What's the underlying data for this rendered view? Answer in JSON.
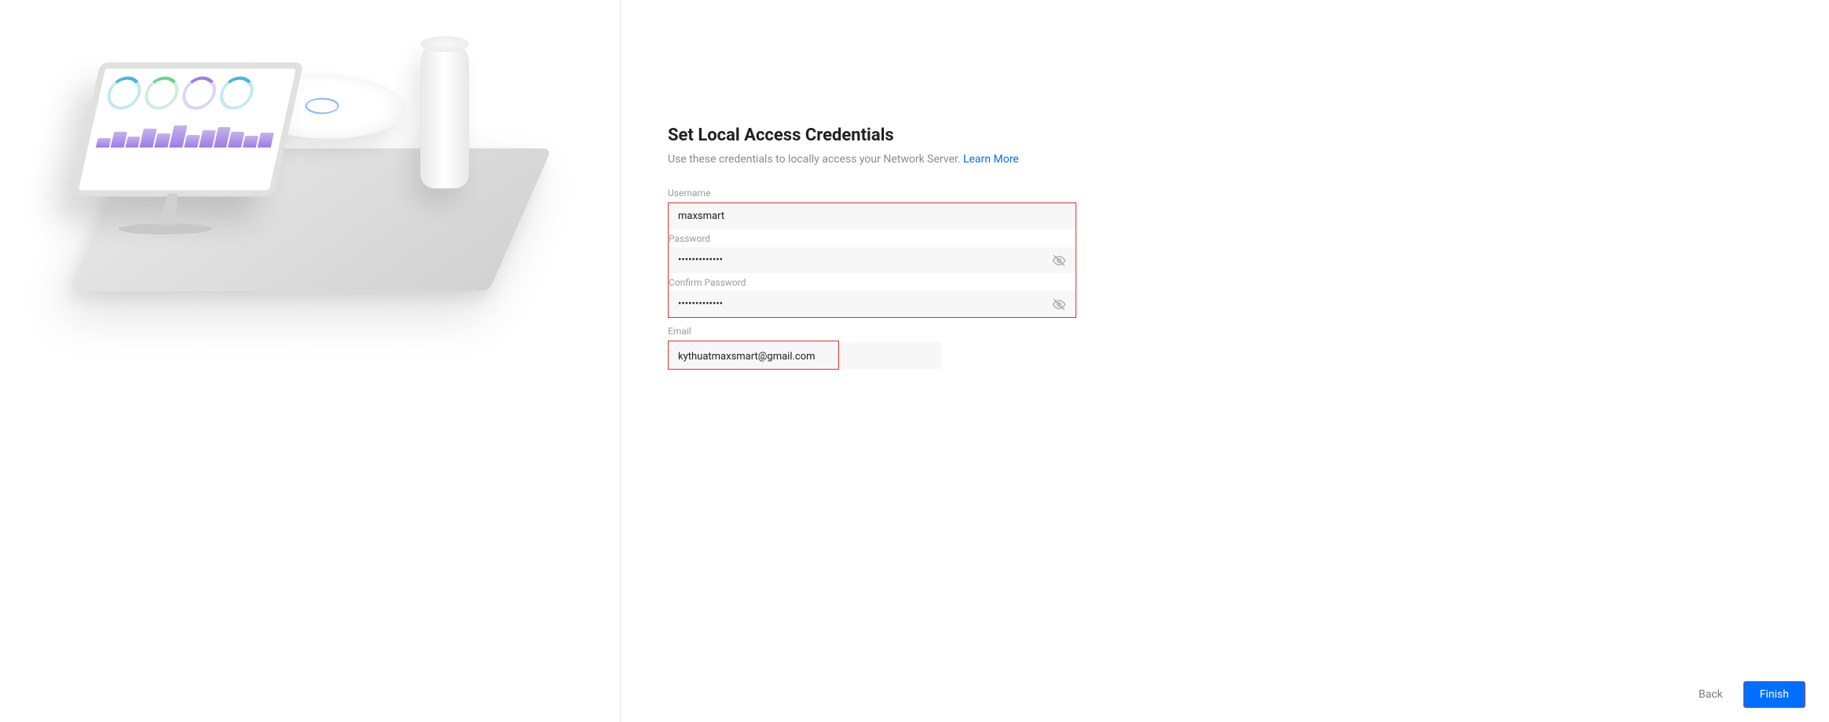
{
  "page": {
    "title": "Set Local Access Credentials",
    "subtitle_prefix": "Use these credentials to locally access your Network Server. ",
    "learn_more": "Learn More"
  },
  "form": {
    "username_label": "Username",
    "username_value": "maxsmart",
    "password_label": "Password",
    "password_value": "•••••••••••••",
    "confirm_label": "Confirm Password",
    "confirm_value": "•••••••••••••",
    "email_label": "Email",
    "email_value": "kythuatmaxsmart@gmail.com"
  },
  "footer": {
    "back_label": "Back",
    "finish_label": "Finish"
  },
  "colors": {
    "accent": "#006fff",
    "highlight_border": "#e03030"
  }
}
